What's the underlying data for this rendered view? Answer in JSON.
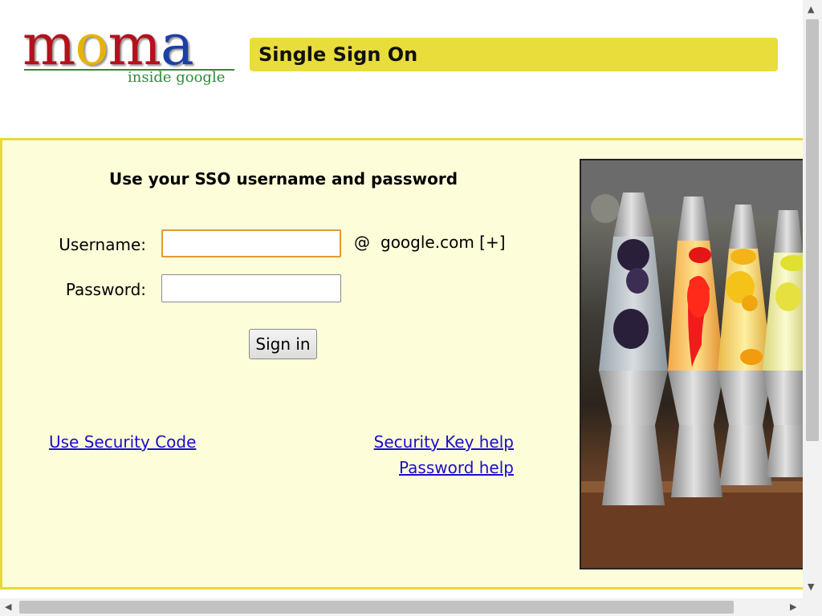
{
  "header": {
    "logo_letters": [
      "m",
      "o",
      "m",
      "a"
    ],
    "logo_colors": [
      "#b3121c",
      "#e8b20b",
      "#b3121c",
      "#1c3fa6"
    ],
    "logo_subtitle": "inside google",
    "title": "Single Sign On"
  },
  "colors": {
    "title_bar": "#e8dd3b",
    "panel_background": "#fefdd9",
    "panel_border": "#e6d93a",
    "link": "#1a0dcc"
  },
  "form": {
    "instruction": "Use your SSO username and password",
    "username_label": "Username:",
    "username_value": "",
    "at_sign": "@",
    "domain": "google.com [+]",
    "password_label": "Password:",
    "password_value": "",
    "signin_label": "Sign in"
  },
  "links": {
    "security_code": "Use Security Code",
    "security_key_help": "Security Key help",
    "password_help": "Password help"
  },
  "image": {
    "icon": "lava-lamps-photo"
  }
}
